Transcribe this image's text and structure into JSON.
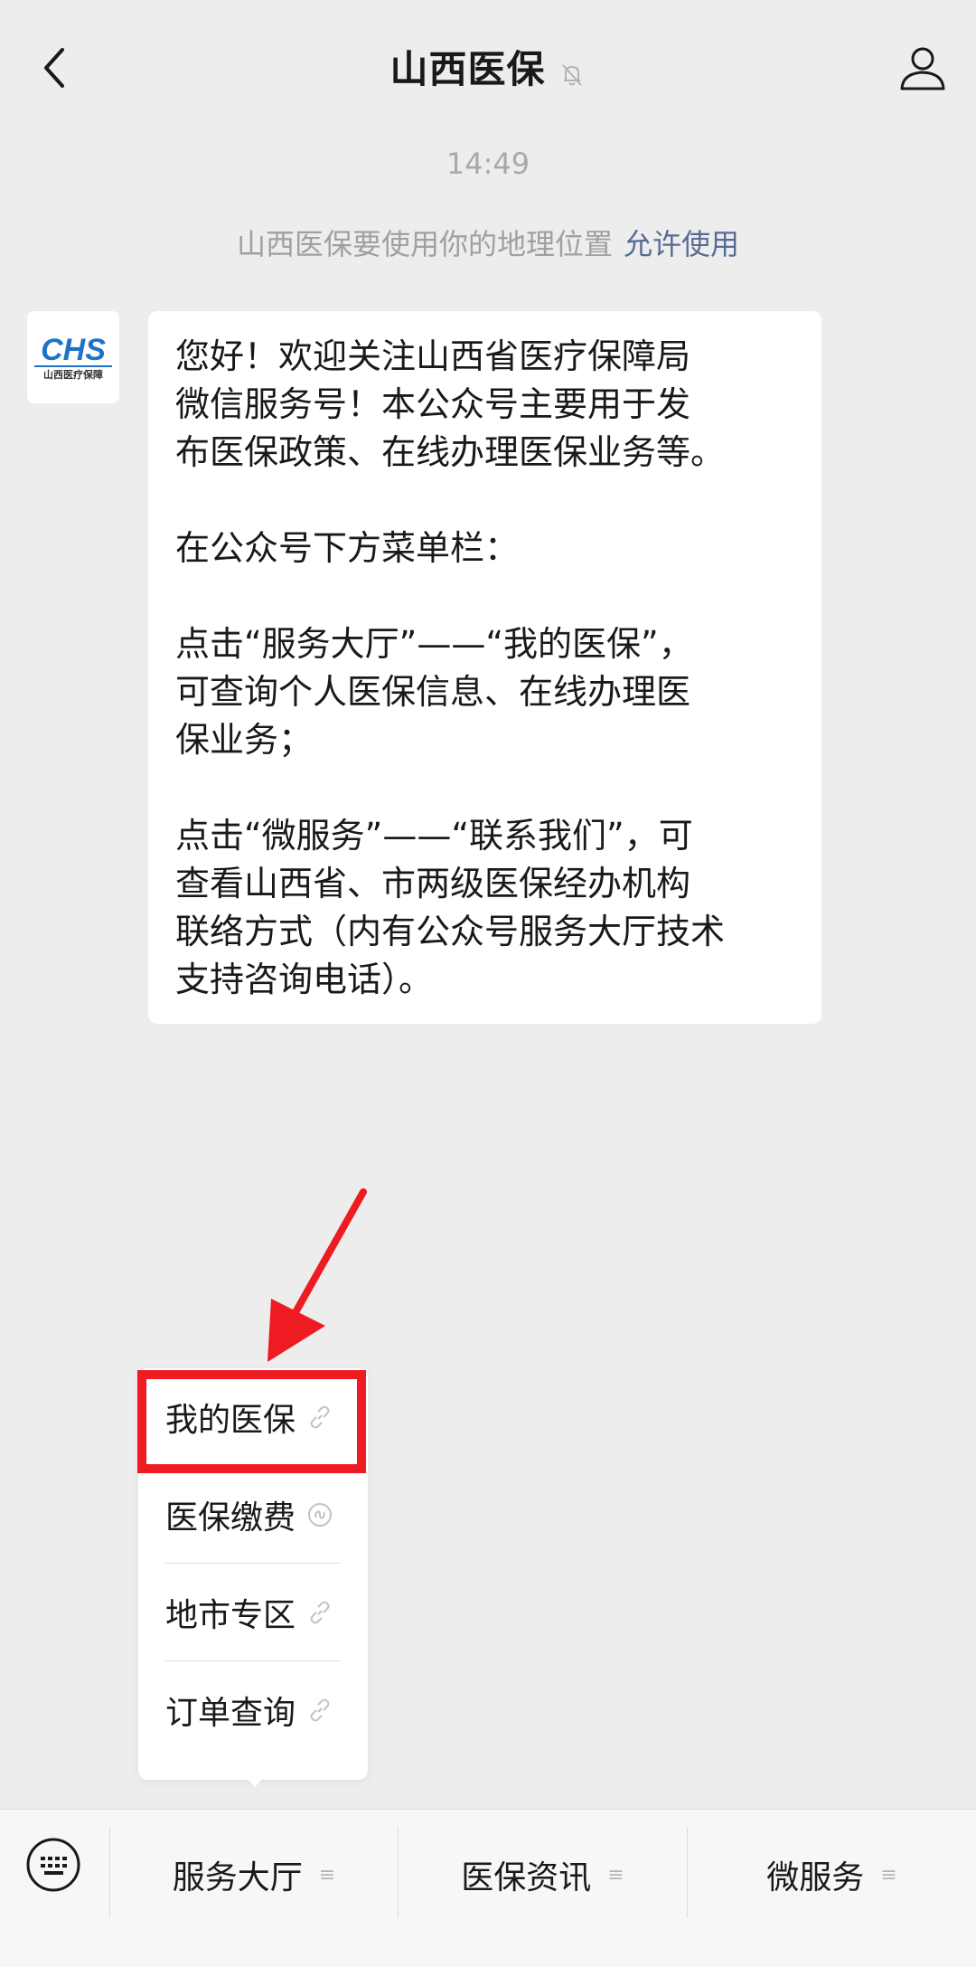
{
  "header": {
    "title": "山西医保"
  },
  "chat": {
    "timestamp": "14:49",
    "location_notice": "山西医保要使用你的地理位置",
    "location_allow": "允许使用",
    "avatar_logo": "CHS",
    "avatar_logo_sub": "山西医疗保障",
    "message_lines": [
      "您好！欢迎关注山西省医疗保障局",
      "微信服务号！本公众号主要用于发",
      "布医保政策、在线办理医保业务等。",
      "",
      "在公众号下方菜单栏：",
      "",
      "点击“服务大厅”——“我的医保”，",
      "可查询个人医保信息、在线办理医",
      "保业务；",
      "",
      "点击“微服务”——“联系我们”，可",
      "查看山西省、市两级医保经办机构",
      "联络方式（内有公众号服务大厅技术",
      "支持咨询电话）。"
    ]
  },
  "submenu": {
    "items": [
      {
        "label": "我的医保",
        "icon": "link-icon"
      },
      {
        "label": "医保缴费",
        "icon": "miniprogram-icon"
      },
      {
        "label": "地市专区",
        "icon": "link-icon"
      },
      {
        "label": "订单查询",
        "icon": "link-icon"
      }
    ],
    "highlighted_index": 0,
    "highlight_color": "#ee1b22"
  },
  "bottom_menu": {
    "tabs": [
      {
        "label": "服务大厅"
      },
      {
        "label": "医保资讯"
      },
      {
        "label": "微服务"
      }
    ],
    "menu_icon": "≡"
  },
  "colors": {
    "background": "#ededed",
    "link": "#576b95",
    "annotation_red": "#ee1b22",
    "logo_blue": "#1e73c8"
  }
}
